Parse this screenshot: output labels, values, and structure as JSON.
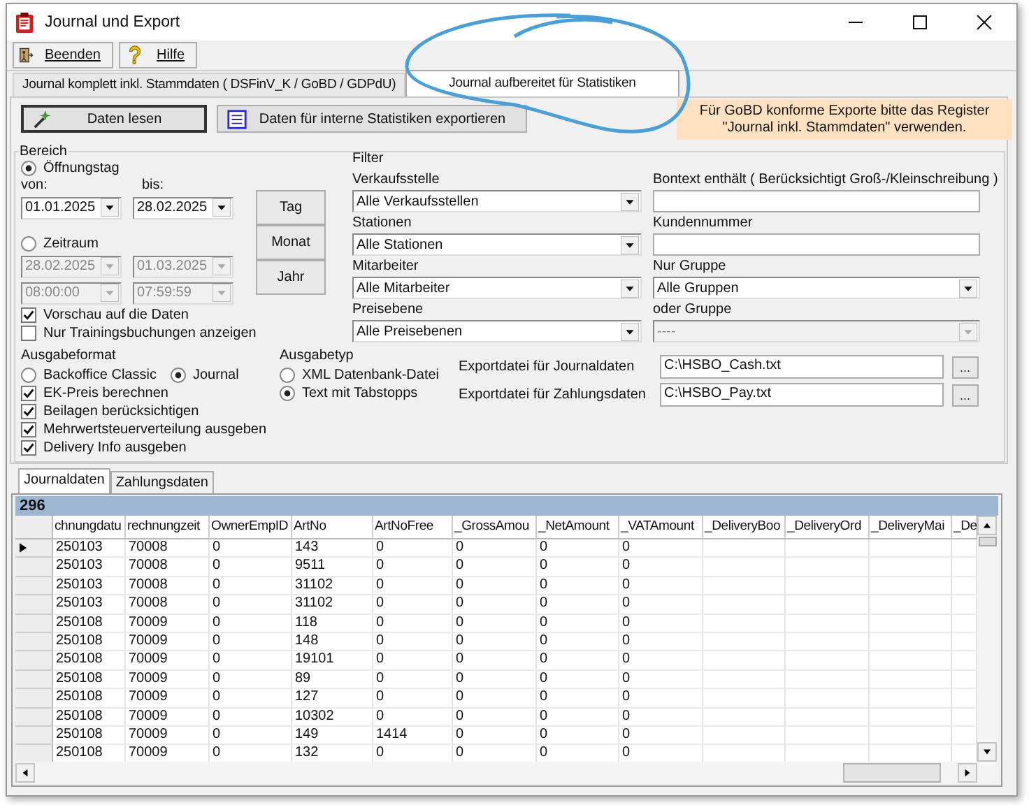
{
  "window": {
    "title": "Journal und Export"
  },
  "toolbar": [
    {
      "label": "Beenden",
      "kind": "exit"
    },
    {
      "label": "Hilfe",
      "kind": "help"
    }
  ],
  "tabs": [
    {
      "label": "Journal komplett inkl. Stammdaten ( DSFinV_K / GoBD / GDPdU)",
      "selected": false
    },
    {
      "label": "Journal aufbereitet für Statistiken",
      "selected": true
    }
  ],
  "actions": [
    {
      "label": "Daten lesen",
      "kind": "read"
    },
    {
      "label": "Daten für interne Statistiken exportieren",
      "kind": "export"
    }
  ],
  "notice": "Für GoBD konforme Exporte bitte das Register \"Journal inkl. Stammdaten\" verwenden.",
  "range": {
    "title": "Bereich",
    "opening_day": {
      "label": "Öffnungstag",
      "selected": true,
      "from_label": "von:",
      "to_label": "bis:",
      "from": "01.01.2025",
      "to": "28.02.2025"
    },
    "period": {
      "label": "Zeitraum",
      "selected": false,
      "disabled": true,
      "from_date": "28.02.2025",
      "to_date": "01.03.2025",
      "from_time": "08:00:00",
      "to_time": "07:59:59"
    },
    "quick_buttons": [
      "Tag",
      "Monat",
      "Jahr"
    ],
    "options": [
      {
        "label": "Vorschau auf die Daten",
        "checked": true
      },
      {
        "label": "Nur Trainingsbuchungen anzeigen",
        "checked": false
      }
    ],
    "filter": {
      "title": "Filter",
      "columns": [
        {
          "fields": [
            {
              "label": "Verkaufsstelle",
              "kind": "combo",
              "value": "Alle Verkaufsstellen",
              "disabled": false
            },
            {
              "label": "Stationen",
              "kind": "combo",
              "value": "Alle Stationen",
              "disabled": false
            },
            {
              "label": "Mitarbeiter",
              "kind": "combo",
              "value": "Alle Mitarbeiter",
              "disabled": false
            },
            {
              "label": "Preisebene",
              "kind": "combo",
              "value": "Alle Preisebenen",
              "disabled": false
            }
          ]
        },
        {
          "fields": [
            {
              "label": "Bontext enthält ( Berücksichtigt Groß-/Kleinschreibung )",
              "kind": "text"
            },
            {
              "label": "Kundennummer",
              "kind": "text"
            },
            {
              "label": "Nur Gruppe",
              "kind": "combo",
              "value": "Alle Gruppen",
              "disabled": false
            },
            {
              "label": "oder Gruppe",
              "kind": "combo",
              "value": "----",
              "disabled": true
            }
          ]
        }
      ]
    },
    "output_format": {
      "title": "Ausgabeformat",
      "choices": [
        {
          "label": "Backoffice Classic",
          "selected": false
        },
        {
          "label": "Journal",
          "selected": true
        }
      ],
      "checks": [
        {
          "label": "EK-Preis berechnen",
          "checked": true
        },
        {
          "label": "Beilagen berücksichtigen",
          "checked": true
        },
        {
          "label": "Mehrwertsteuerverteilung ausgeben",
          "checked": true
        },
        {
          "label": "Delivery Info ausgeben",
          "checked": true
        }
      ]
    },
    "output_type": {
      "title": "Ausgabetyp",
      "choices": [
        {
          "label": "XML Datenbank-Datei",
          "selected": false
        },
        {
          "label": "Text mit Tabstopps",
          "selected": true
        }
      ]
    },
    "exports": [
      {
        "label": "Exportdatei für Journaldaten",
        "value": "C:\\HSBO_Cash.txt",
        "button": "..."
      },
      {
        "label": "Exportdatei für Zahlungsdaten",
        "value": "C:\\HSBO_Pay.txt",
        "button": "..."
      }
    ]
  },
  "data_tabs": [
    {
      "label": "Journaldaten",
      "selected": true
    },
    {
      "label": "Zahlungsdaten",
      "selected": false
    }
  ],
  "grid": {
    "count": "296",
    "columns": [
      "chnungdatu",
      "rechnungzeit",
      "OwnerEmpID",
      "ArtNo",
      "ArtNoFree",
      "_GrossAmou",
      "_NetAmount",
      "_VATAmount",
      "_DeliveryBoo",
      "_DeliveryOrd",
      "_DeliveryMai",
      "_De"
    ],
    "rows": [
      {
        "current": true,
        "cells": [
          "250103",
          "70008",
          "0",
          "143",
          "0",
          "0",
          "0",
          "0"
        ]
      },
      {
        "current": false,
        "cells": [
          "250103",
          "70008",
          "0",
          "9511",
          "0",
          "0",
          "0",
          "0"
        ]
      },
      {
        "current": false,
        "cells": [
          "250103",
          "70008",
          "0",
          "31102",
          "0",
          "0",
          "0",
          "0"
        ]
      },
      {
        "current": false,
        "cells": [
          "250103",
          "70008",
          "0",
          "31102",
          "0",
          "0",
          "0",
          "0"
        ]
      },
      {
        "current": false,
        "cells": [
          "250108",
          "70009",
          "0",
          "118",
          "0",
          "0",
          "0",
          "0"
        ]
      },
      {
        "current": false,
        "cells": [
          "250108",
          "70009",
          "0",
          "148",
          "0",
          "0",
          "0",
          "0"
        ]
      },
      {
        "current": false,
        "cells": [
          "250108",
          "70009",
          "0",
          "19101",
          "0",
          "0",
          "0",
          "0"
        ]
      },
      {
        "current": false,
        "cells": [
          "250108",
          "70009",
          "0",
          "89",
          "0",
          "0",
          "0",
          "0"
        ]
      },
      {
        "current": false,
        "cells": [
          "250108",
          "70009",
          "0",
          "127",
          "0",
          "0",
          "0",
          "0"
        ]
      },
      {
        "current": false,
        "cells": [
          "250108",
          "70009",
          "0",
          "10302",
          "0",
          "0",
          "0",
          "0"
        ]
      },
      {
        "current": false,
        "cells": [
          "250108",
          "70009",
          "0",
          "149",
          "1414",
          "0",
          "0",
          "0"
        ]
      },
      {
        "current": false,
        "cells": [
          "250108",
          "70009",
          "0",
          "132",
          "0",
          "0",
          "0",
          "0"
        ]
      }
    ]
  }
}
